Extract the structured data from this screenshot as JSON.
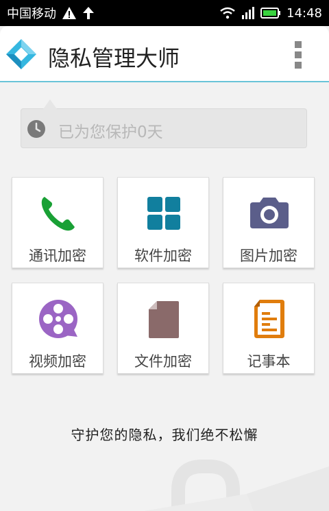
{
  "status_bar": {
    "carrier": "中国移动",
    "time": "14:48"
  },
  "header": {
    "title": "隐私管理大师"
  },
  "protect_banner": {
    "text": "已为您保护0天"
  },
  "tiles": [
    {
      "label": "通讯加密",
      "icon": "phone-icon",
      "color": "#19a035"
    },
    {
      "label": "软件加密",
      "icon": "apps-grid-icon",
      "color": "#117f9e"
    },
    {
      "label": "图片加密",
      "icon": "camera-icon",
      "color": "#5b5e8a"
    },
    {
      "label": "视频加密",
      "icon": "film-reel-icon",
      "color": "#9b65c4"
    },
    {
      "label": "文件加密",
      "icon": "document-icon",
      "color": "#8a6a6a"
    },
    {
      "label": "记事本",
      "icon": "notepad-icon",
      "color": "#e07d0d"
    }
  ],
  "slogan": "守护您的隐私，我们绝不松懈"
}
